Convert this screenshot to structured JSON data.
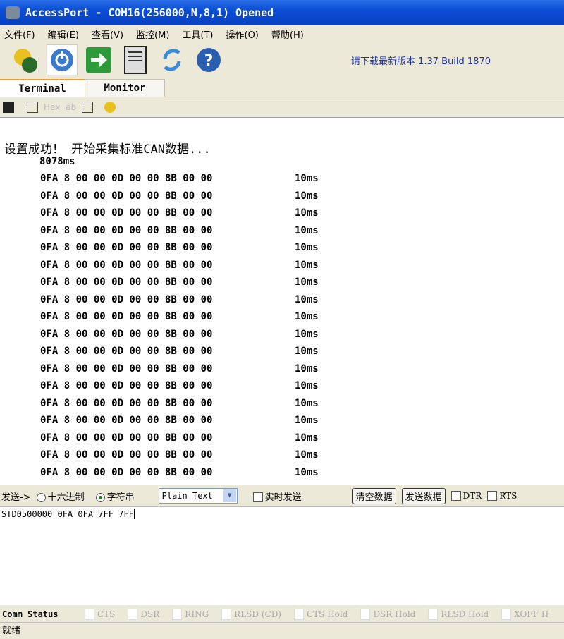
{
  "window": {
    "title": "AccessPort - COM16(256000,N,8,1) Opened"
  },
  "menu": [
    "文件(F)",
    "编辑(E)",
    "查看(V)",
    "监控(M)",
    "工具(T)",
    "操作(O)",
    "帮助(H)"
  ],
  "toolbar": {
    "update_link": "请下载最新版本 1.37 Build 1870"
  },
  "tabs": [
    "Terminal",
    "Monitor"
  ],
  "subtoolbar": {
    "hex": "Hex",
    "ab": "ab"
  },
  "terminal": {
    "message": "设置成功！  开始采集标准CAN数据...",
    "time": "8078ms",
    "rows": [
      {
        "data": "0FA 8 00 00 0D 00 00 8B 00 00",
        "ms": "10ms"
      },
      {
        "data": "0FA 8 00 00 0D 00 00 8B 00 00",
        "ms": "10ms"
      },
      {
        "data": "0FA 8 00 00 0D 00 00 8B 00 00",
        "ms": "10ms"
      },
      {
        "data": "0FA 8 00 00 0D 00 00 8B 00 00",
        "ms": "10ms"
      },
      {
        "data": "0FA 8 00 00 0D 00 00 8B 00 00",
        "ms": "10ms"
      },
      {
        "data": "0FA 8 00 00 0D 00 00 8B 00 00",
        "ms": "10ms"
      },
      {
        "data": "0FA 8 00 00 0D 00 00 8B 00 00",
        "ms": "10ms"
      },
      {
        "data": "0FA 8 00 00 0D 00 00 8B 00 00",
        "ms": "10ms"
      },
      {
        "data": "0FA 8 00 00 0D 00 00 8B 00 00",
        "ms": "10ms"
      },
      {
        "data": "0FA 8 00 00 0D 00 00 8B 00 00",
        "ms": "10ms"
      },
      {
        "data": "0FA 8 00 00 0D 00 00 8B 00 00",
        "ms": "10ms"
      },
      {
        "data": "0FA 8 00 00 0D 00 00 8B 00 00",
        "ms": "10ms"
      },
      {
        "data": "0FA 8 00 00 0D 00 00 8B 00 00",
        "ms": "10ms"
      },
      {
        "data": "0FA 8 00 00 0D 00 00 8B 00 00",
        "ms": "10ms"
      },
      {
        "data": "0FA 8 00 00 0D 00 00 8B 00 00",
        "ms": "10ms"
      },
      {
        "data": "0FA 8 00 00 0D 00 00 8B 00 00",
        "ms": "10ms"
      },
      {
        "data": "0FA 8 00 00 0D 00 00 8B 00 00",
        "ms": "10ms"
      },
      {
        "data": "0FA 8 00 00 0D 00 00 8B 00 00",
        "ms": "10ms"
      }
    ]
  },
  "send": {
    "label": "发送->",
    "hex": "十六进制",
    "string": "字符串",
    "format": "Plain Text",
    "realtime": "实时发送",
    "clear": "清空数据",
    "send": "发送数据",
    "dtr": "DTR",
    "rts": "RTS",
    "input": "STD0500000 0FA 0FA 7FF 7FF"
  },
  "comm": {
    "label": "Comm Status",
    "indicators": [
      "CTS",
      "DSR",
      "RING",
      "RLSD (CD)",
      "CTS Hold",
      "DSR Hold",
      "RLSD Hold",
      "XOFF H"
    ]
  },
  "status": "就绪"
}
